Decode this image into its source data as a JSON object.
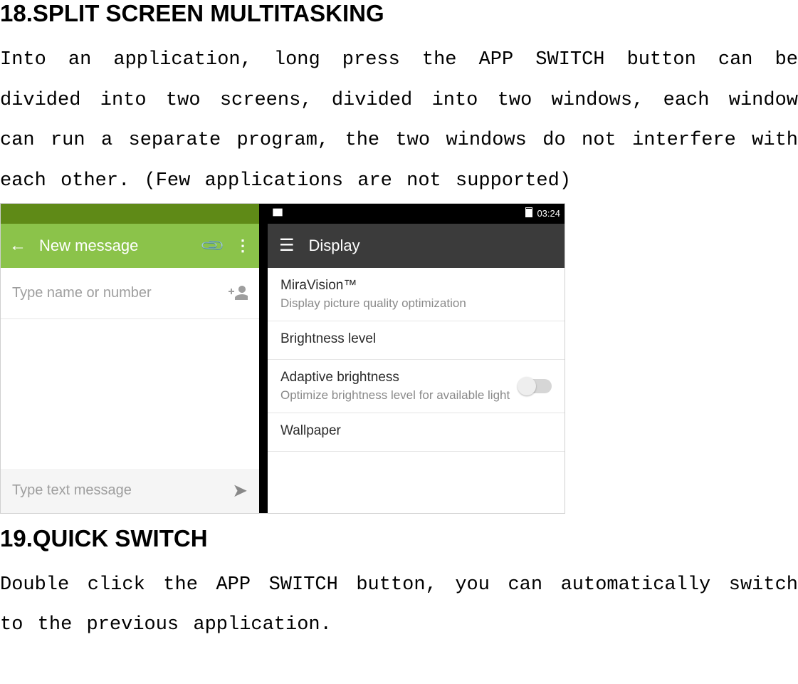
{
  "doc": {
    "heading18": "18.SPLIT SCREEN MULTITASKING",
    "para18": "Into an application, long press the APP SWITCH button can be divided into two screens, divided into two windows, each window can run a separate program, the two windows do not interfere with each other. (Few applications are not supported)",
    "heading19": "19.QUICK SWITCH",
    "para19": "Double click the APP SWITCH button, you can automatically switch to the previous application."
  },
  "screenshot": {
    "left": {
      "appbar_title": "New message",
      "name_placeholder": "Type name or number",
      "compose_placeholder": "Type text message"
    },
    "right": {
      "status_time": "03:24",
      "toolbar_title": "Display",
      "items": [
        {
          "primary": "MiraVision™",
          "secondary": "Display picture quality optimization"
        },
        {
          "primary": "Brightness level",
          "secondary": ""
        },
        {
          "primary": "Adaptive brightness",
          "secondary": "Optimize brightness level for available light"
        },
        {
          "primary": "Wallpaper",
          "secondary": ""
        }
      ]
    }
  }
}
